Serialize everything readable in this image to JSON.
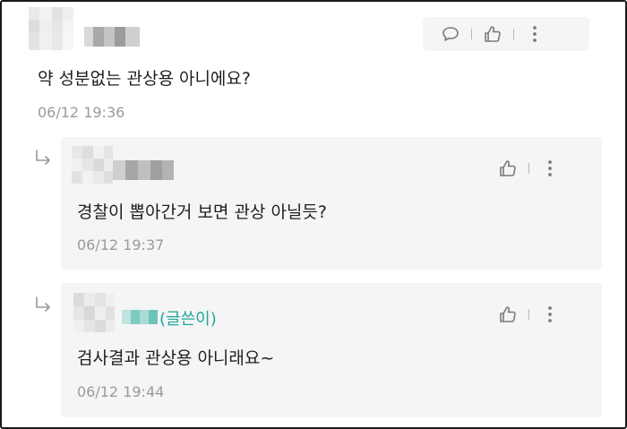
{
  "colors": {
    "text": "#1f1f1f",
    "time": "#9a9a9a",
    "author_accent": "#1fa89a",
    "panel": "#f5f5f5"
  },
  "icons": {
    "comment": "speech-bubble-icon",
    "like": "thumbs-up-icon",
    "more": "vertical-ellipsis-icon",
    "reply": "reply-arrow-icon"
  },
  "comments": [
    {
      "text": "약 성분없는 관상용 아니에요?",
      "time": "06/12 19:36"
    }
  ],
  "replies": [
    {
      "text": "경찰이 뽑아간거 보면 관상 아닐듯?",
      "time": "06/12 19:37"
    },
    {
      "author_tag": "(글쓴이)",
      "text": "검사결과 관상용 아니래요~",
      "time": "06/12 19:44"
    }
  ]
}
